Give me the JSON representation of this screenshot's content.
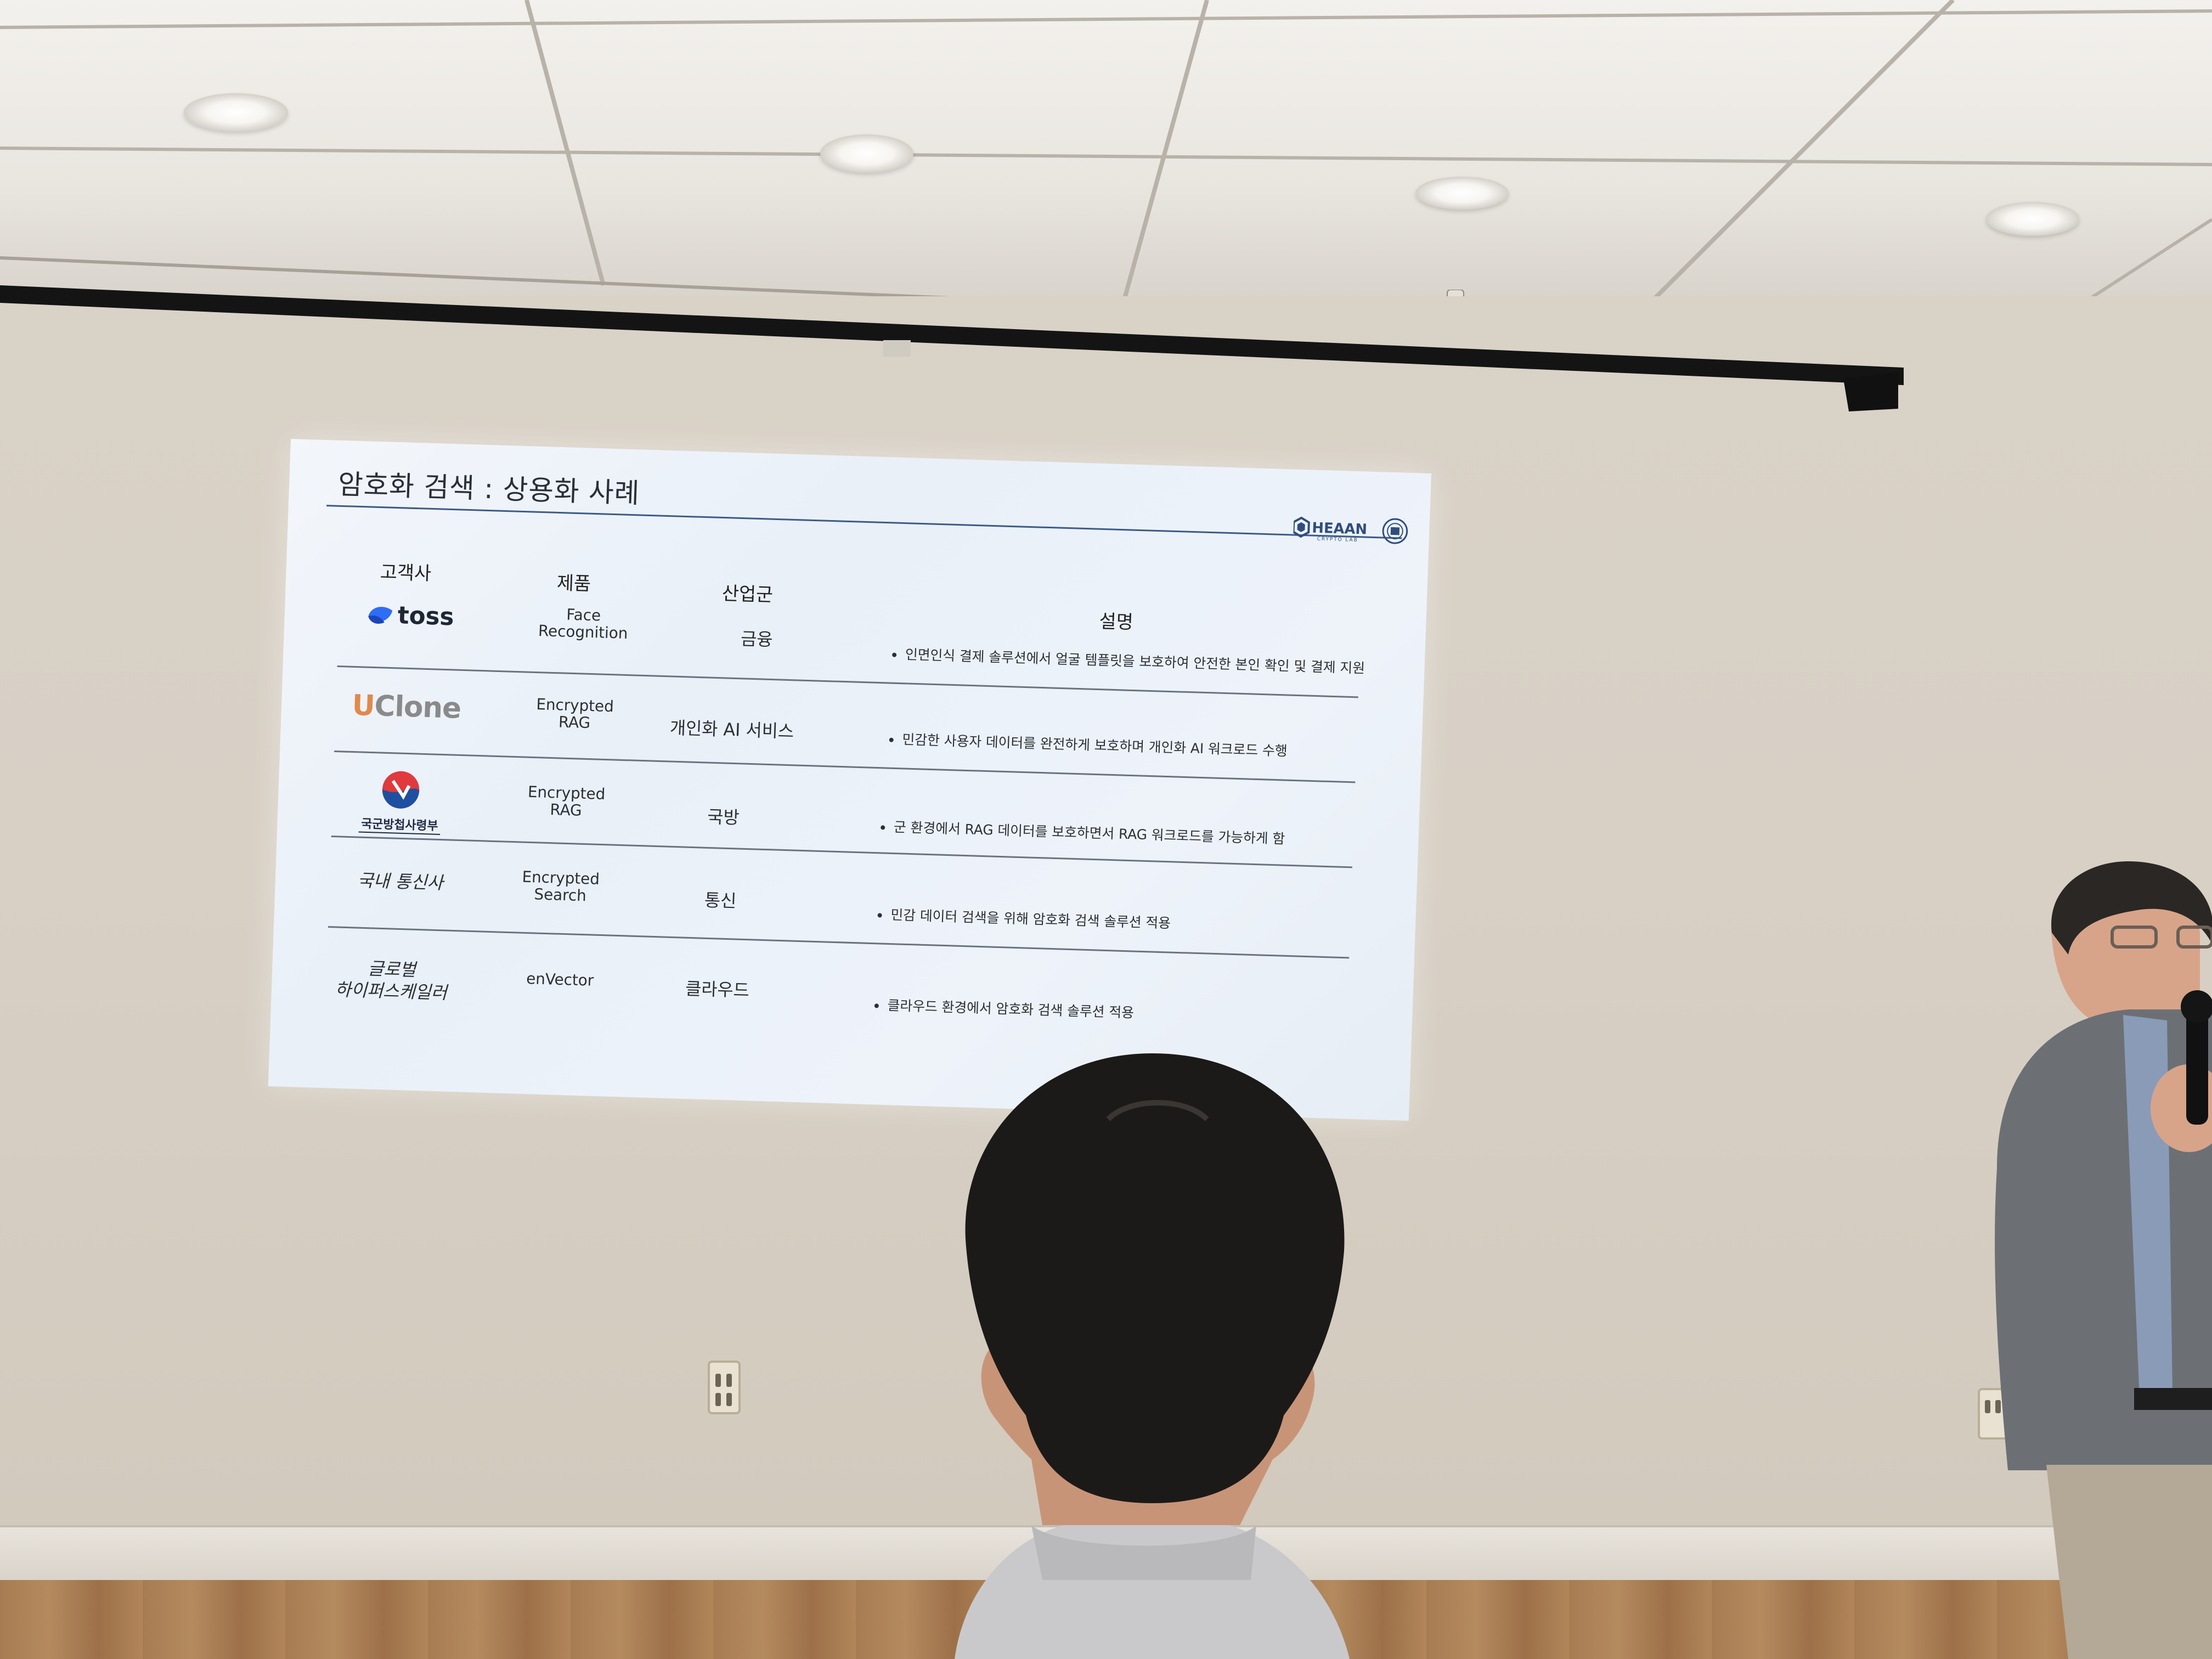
{
  "slide": {
    "title": "암호화 검색 : 상용화 사례",
    "columns": [
      "고객사",
      "제품",
      "산업군",
      "설명"
    ],
    "rows": [
      {
        "customer": "toss",
        "customer_kind": "logo",
        "product": [
          "Face",
          "Recognition"
        ],
        "industry": "금융",
        "description": "인면인식 결제 솔루션에서 얼굴 템플릿을 보호하여 안전한 본인 확인 및 결제 지원"
      },
      {
        "customer": "UClone",
        "customer_kind": "logo",
        "product": [
          "Encrypted",
          "RAG"
        ],
        "industry": "개인화 AI 서비스",
        "description": "민감한 사용자 데이터를 완전하게 보호하며 개인화 AI 워크로드 수행"
      },
      {
        "customer": "국군방첩사령부",
        "customer_kind": "emblem",
        "product": [
          "Encrypted",
          "RAG"
        ],
        "industry": "국방",
        "description": "군 환경에서 RAG 데이터를 보호하면서 RAG 워크로드를 가능하게 함"
      },
      {
        "customer": "국내 통신사",
        "customer_kind": "text",
        "product": [
          "Encrypted",
          "Search"
        ],
        "industry": "통신",
        "description": "민감 데이터 검색을 위해 암호화 검색 솔루션 적용"
      },
      {
        "customer": [
          "글로벌",
          "하이퍼스케일러"
        ],
        "customer_kind": "text",
        "product": [
          "enVector"
        ],
        "industry": "클라우드",
        "description": "클라우드 환경에서 암호화 검색 솔루션 적용"
      }
    ],
    "brand_logo": "HEAAN",
    "brand_logo_sub": "CRYPTO LAB",
    "accent_color": "#3d5b86"
  },
  "scene": {
    "objects": [
      "ceiling-light-icon",
      "sprinkler-icon",
      "wall-outlet-icon",
      "audience-member-head",
      "presenter-with-microphone"
    ]
  }
}
